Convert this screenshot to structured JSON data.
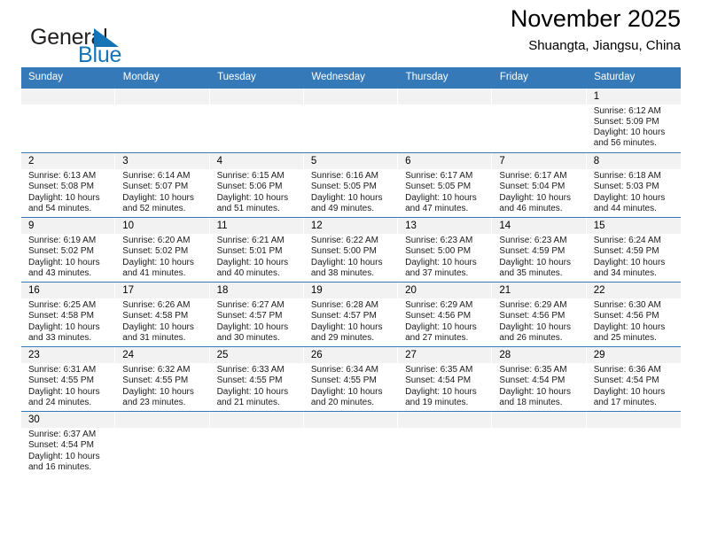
{
  "brand": {
    "name_part1": "General",
    "name_part2": "Blue",
    "flag_icon": "blue-triangle-flag-icon",
    "color_dark": "#231f20",
    "color_blue": "#1574b5"
  },
  "header": {
    "title": "November 2025",
    "subtitle": "Shuangta, Jiangsu, China"
  },
  "theme": {
    "header_bar": "#3579b8",
    "daynum_band": "#f2f2f2",
    "row_divider": "#3579b8"
  },
  "weekday_headers": [
    "Sunday",
    "Monday",
    "Tuesday",
    "Wednesday",
    "Thursday",
    "Friday",
    "Saturday"
  ],
  "labels": {
    "sunrise": "Sunrise:",
    "sunset": "Sunset:",
    "daylight": "Daylight:"
  },
  "weeks": [
    [
      {
        "empty": true
      },
      {
        "empty": true
      },
      {
        "empty": true
      },
      {
        "empty": true
      },
      {
        "empty": true
      },
      {
        "empty": true
      },
      {
        "day": "1",
        "sunrise": "Sunrise: 6:12 AM",
        "sunset": "Sunset: 5:09 PM",
        "daylight": "Daylight: 10 hours and 56 minutes."
      }
    ],
    [
      {
        "day": "2",
        "sunrise": "Sunrise: 6:13 AM",
        "sunset": "Sunset: 5:08 PM",
        "daylight": "Daylight: 10 hours and 54 minutes."
      },
      {
        "day": "3",
        "sunrise": "Sunrise: 6:14 AM",
        "sunset": "Sunset: 5:07 PM",
        "daylight": "Daylight: 10 hours and 52 minutes."
      },
      {
        "day": "4",
        "sunrise": "Sunrise: 6:15 AM",
        "sunset": "Sunset: 5:06 PM",
        "daylight": "Daylight: 10 hours and 51 minutes."
      },
      {
        "day": "5",
        "sunrise": "Sunrise: 6:16 AM",
        "sunset": "Sunset: 5:05 PM",
        "daylight": "Daylight: 10 hours and 49 minutes."
      },
      {
        "day": "6",
        "sunrise": "Sunrise: 6:17 AM",
        "sunset": "Sunset: 5:05 PM",
        "daylight": "Daylight: 10 hours and 47 minutes."
      },
      {
        "day": "7",
        "sunrise": "Sunrise: 6:17 AM",
        "sunset": "Sunset: 5:04 PM",
        "daylight": "Daylight: 10 hours and 46 minutes."
      },
      {
        "day": "8",
        "sunrise": "Sunrise: 6:18 AM",
        "sunset": "Sunset: 5:03 PM",
        "daylight": "Daylight: 10 hours and 44 minutes."
      }
    ],
    [
      {
        "day": "9",
        "sunrise": "Sunrise: 6:19 AM",
        "sunset": "Sunset: 5:02 PM",
        "daylight": "Daylight: 10 hours and 43 minutes."
      },
      {
        "day": "10",
        "sunrise": "Sunrise: 6:20 AM",
        "sunset": "Sunset: 5:02 PM",
        "daylight": "Daylight: 10 hours and 41 minutes."
      },
      {
        "day": "11",
        "sunrise": "Sunrise: 6:21 AM",
        "sunset": "Sunset: 5:01 PM",
        "daylight": "Daylight: 10 hours and 40 minutes."
      },
      {
        "day": "12",
        "sunrise": "Sunrise: 6:22 AM",
        "sunset": "Sunset: 5:00 PM",
        "daylight": "Daylight: 10 hours and 38 minutes."
      },
      {
        "day": "13",
        "sunrise": "Sunrise: 6:23 AM",
        "sunset": "Sunset: 5:00 PM",
        "daylight": "Daylight: 10 hours and 37 minutes."
      },
      {
        "day": "14",
        "sunrise": "Sunrise: 6:23 AM",
        "sunset": "Sunset: 4:59 PM",
        "daylight": "Daylight: 10 hours and 35 minutes."
      },
      {
        "day": "15",
        "sunrise": "Sunrise: 6:24 AM",
        "sunset": "Sunset: 4:59 PM",
        "daylight": "Daylight: 10 hours and 34 minutes."
      }
    ],
    [
      {
        "day": "16",
        "sunrise": "Sunrise: 6:25 AM",
        "sunset": "Sunset: 4:58 PM",
        "daylight": "Daylight: 10 hours and 33 minutes."
      },
      {
        "day": "17",
        "sunrise": "Sunrise: 6:26 AM",
        "sunset": "Sunset: 4:58 PM",
        "daylight": "Daylight: 10 hours and 31 minutes."
      },
      {
        "day": "18",
        "sunrise": "Sunrise: 6:27 AM",
        "sunset": "Sunset: 4:57 PM",
        "daylight": "Daylight: 10 hours and 30 minutes."
      },
      {
        "day": "19",
        "sunrise": "Sunrise: 6:28 AM",
        "sunset": "Sunset: 4:57 PM",
        "daylight": "Daylight: 10 hours and 29 minutes."
      },
      {
        "day": "20",
        "sunrise": "Sunrise: 6:29 AM",
        "sunset": "Sunset: 4:56 PM",
        "daylight": "Daylight: 10 hours and 27 minutes."
      },
      {
        "day": "21",
        "sunrise": "Sunrise: 6:29 AM",
        "sunset": "Sunset: 4:56 PM",
        "daylight": "Daylight: 10 hours and 26 minutes."
      },
      {
        "day": "22",
        "sunrise": "Sunrise: 6:30 AM",
        "sunset": "Sunset: 4:56 PM",
        "daylight": "Daylight: 10 hours and 25 minutes."
      }
    ],
    [
      {
        "day": "23",
        "sunrise": "Sunrise: 6:31 AM",
        "sunset": "Sunset: 4:55 PM",
        "daylight": "Daylight: 10 hours and 24 minutes."
      },
      {
        "day": "24",
        "sunrise": "Sunrise: 6:32 AM",
        "sunset": "Sunset: 4:55 PM",
        "daylight": "Daylight: 10 hours and 23 minutes."
      },
      {
        "day": "25",
        "sunrise": "Sunrise: 6:33 AM",
        "sunset": "Sunset: 4:55 PM",
        "daylight": "Daylight: 10 hours and 21 minutes."
      },
      {
        "day": "26",
        "sunrise": "Sunrise: 6:34 AM",
        "sunset": "Sunset: 4:55 PM",
        "daylight": "Daylight: 10 hours and 20 minutes."
      },
      {
        "day": "27",
        "sunrise": "Sunrise: 6:35 AM",
        "sunset": "Sunset: 4:54 PM",
        "daylight": "Daylight: 10 hours and 19 minutes."
      },
      {
        "day": "28",
        "sunrise": "Sunrise: 6:35 AM",
        "sunset": "Sunset: 4:54 PM",
        "daylight": "Daylight: 10 hours and 18 minutes."
      },
      {
        "day": "29",
        "sunrise": "Sunrise: 6:36 AM",
        "sunset": "Sunset: 4:54 PM",
        "daylight": "Daylight: 10 hours and 17 minutes."
      }
    ],
    [
      {
        "day": "30",
        "sunrise": "Sunrise: 6:37 AM",
        "sunset": "Sunset: 4:54 PM",
        "daylight": "Daylight: 10 hours and 16 minutes."
      },
      {
        "empty": true
      },
      {
        "empty": true
      },
      {
        "empty": true
      },
      {
        "empty": true
      },
      {
        "empty": true
      },
      {
        "empty": true
      }
    ]
  ]
}
